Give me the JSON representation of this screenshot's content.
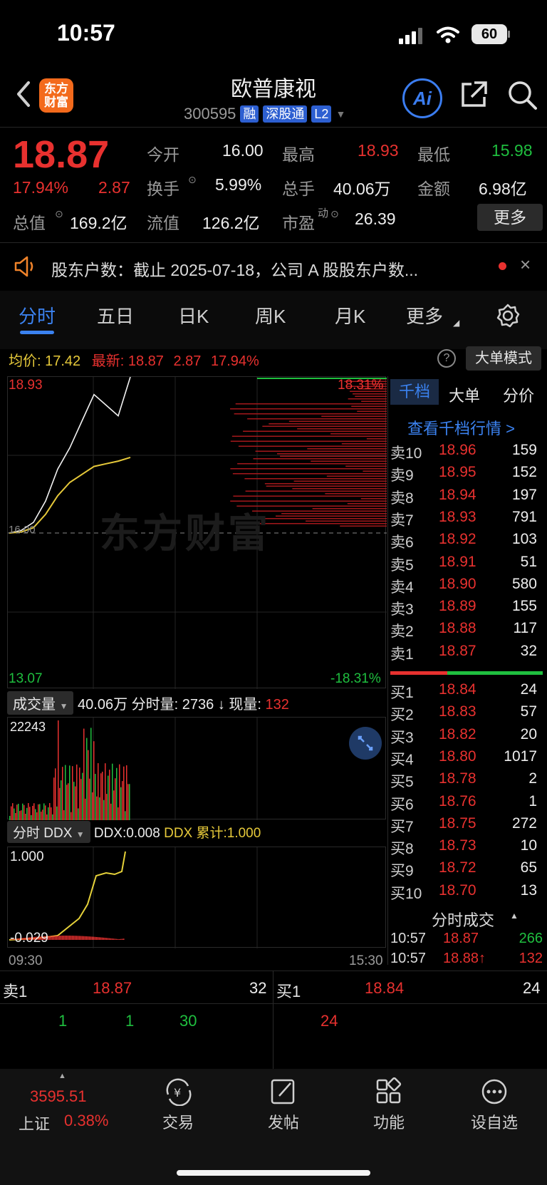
{
  "status": {
    "time": "10:57",
    "battery": "60"
  },
  "header": {
    "name": "欧普康视",
    "code": "300595",
    "tags": [
      "融",
      "深股通",
      "L2"
    ],
    "logo": "东方财富",
    "ai": "Ai"
  },
  "quote": {
    "price": "18.87",
    "pct": "17.94%",
    "change": "2.87",
    "open_label": "今开",
    "open": "16.00",
    "high_label": "最高",
    "high": "18.93",
    "low_label": "最低",
    "low": "15.98",
    "turnover_label": "换手",
    "turnover": "5.99%",
    "volume_label": "总手",
    "volume": "40.06万",
    "amount_label": "金额",
    "amount": "6.98亿",
    "mcap_label": "总值",
    "mcap": "169.2亿",
    "float_label": "流值",
    "float": "126.2亿",
    "pe_label": "市盈",
    "pe_sup": "动",
    "pe": "26.39",
    "more": "更多"
  },
  "notice": {
    "text": "股东户数：截止 2025-07-18，公司 A 股股东户数..."
  },
  "tabs": [
    "分时",
    "五日",
    "日K",
    "周K",
    "月K",
    "更多"
  ],
  "info_bar": {
    "avg_label": "均价:",
    "avg": "17.42",
    "latest_label": "最新:",
    "latest": "18.87",
    "change": "2.87",
    "pct": "17.94%",
    "mode": "大单模式"
  },
  "chart": {
    "y_max": "18.93",
    "y_min": "13.07",
    "pct_max": "18.31%",
    "pct_min": "-18.31%",
    "mid": "16.00",
    "watermark": "东方财富",
    "volume_panel": {
      "label": "成交量",
      "total": "40.06万",
      "minute_label": "分时量:",
      "minute": "2736",
      "arrow": "↓",
      "now_label": "现量:",
      "now": "132",
      "max": "22243"
    },
    "ddx_panel": {
      "label": "分时 DDX",
      "ddx": "DDX:0.008",
      "cum": "DDX 累计:1.000",
      "max": "1.000",
      "min": "-0.029"
    },
    "time_start": "09:30",
    "time_end": "15:30"
  },
  "chart_data": {
    "type": "line",
    "series": [
      {
        "name": "最新",
        "values": [
          16.0,
          16.05,
          16.2,
          16.6,
          17.2,
          17.6,
          18.1,
          18.6,
          18.4,
          18.2,
          18.93
        ]
      },
      {
        "name": "均价",
        "values": [
          16.0,
          16.02,
          16.1,
          16.35,
          16.7,
          16.95,
          17.1,
          17.25,
          17.3,
          17.35,
          17.42
        ]
      }
    ],
    "ylim": [
      13.07,
      18.93
    ]
  },
  "orderbook": {
    "tabs": [
      "千档",
      "大单",
      "分价"
    ],
    "link": "查看千档行情 >",
    "asks": [
      {
        "label": "卖10",
        "price": "18.96",
        "vol": "159"
      },
      {
        "label": "卖9",
        "price": "18.95",
        "vol": "152"
      },
      {
        "label": "卖8",
        "price": "18.94",
        "vol": "197"
      },
      {
        "label": "卖7",
        "price": "18.93",
        "vol": "791"
      },
      {
        "label": "卖6",
        "price": "18.92",
        "vol": "103"
      },
      {
        "label": "卖5",
        "price": "18.91",
        "vol": "51"
      },
      {
        "label": "卖4",
        "price": "18.90",
        "vol": "580"
      },
      {
        "label": "卖3",
        "price": "18.89",
        "vol": "155"
      },
      {
        "label": "卖2",
        "price": "18.88",
        "vol": "117"
      },
      {
        "label": "卖1",
        "price": "18.87",
        "vol": "32"
      }
    ],
    "bids": [
      {
        "label": "买1",
        "price": "18.84",
        "vol": "24"
      },
      {
        "label": "买2",
        "price": "18.83",
        "vol": "57"
      },
      {
        "label": "买3",
        "price": "18.82",
        "vol": "20"
      },
      {
        "label": "买4",
        "price": "18.80",
        "vol": "1017"
      },
      {
        "label": "买5",
        "price": "18.78",
        "vol": "2"
      },
      {
        "label": "买6",
        "price": "18.76",
        "vol": "1"
      },
      {
        "label": "买7",
        "price": "18.75",
        "vol": "272"
      },
      {
        "label": "买8",
        "price": "18.73",
        "vol": "10"
      },
      {
        "label": "买9",
        "price": "18.72",
        "vol": "65"
      },
      {
        "label": "买10",
        "price": "18.70",
        "vol": "13"
      }
    ],
    "trades_title": "分时成交",
    "trades": [
      {
        "time": "10:57",
        "price": "18.87",
        "vol": "266"
      },
      {
        "time": "10:57",
        "price": "18.88↑",
        "vol": "132"
      }
    ]
  },
  "queue": {
    "sell_label": "卖1",
    "sell_price": "18.87",
    "sell_vol": "32",
    "buy_label": "买1",
    "buy_price": "18.84",
    "buy_vol": "24",
    "sell_orders": [
      "1",
      "1",
      "30"
    ],
    "buy_orders": [
      "24"
    ]
  },
  "bottom_nav": {
    "index_value": "3595.51",
    "index_name": "上证",
    "index_pct": "0.38%",
    "items": [
      "交易",
      "发帖",
      "功能",
      "设自选"
    ]
  }
}
